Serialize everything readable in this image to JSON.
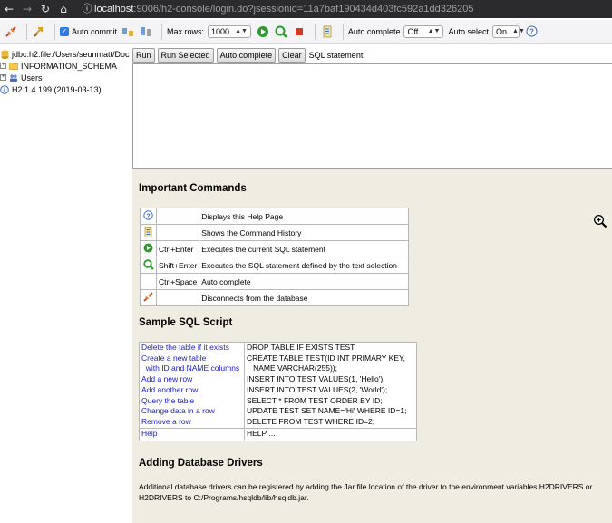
{
  "browser": {
    "back_glyph": "←",
    "forward_glyph": "→",
    "reload_glyph": "↻",
    "home_glyph": "⌂",
    "info_glyph": "ⓘ",
    "url_host": "localhost",
    "url_rest": ":9006/h2-console/login.do?jsessionid=11a7baf190434d403fc592a1dd326205"
  },
  "toolbar": {
    "auto_commit_label": "Auto commit",
    "auto_commit_checked": "✓",
    "max_rows_label": "Max rows:",
    "max_rows_value": "1000",
    "auto_complete_label": "Auto complete",
    "auto_complete_value": "Off",
    "auto_select_label": "Auto select",
    "auto_select_value": "On",
    "select_arrow": "▲▼",
    "help_glyph": "?"
  },
  "tree": {
    "connection": "jdbc:h2:file:/Users/seunmatt/Doc",
    "items": [
      {
        "label": "INFORMATION_SCHEMA"
      },
      {
        "label": "Users"
      }
    ],
    "version": "H2 1.4.199 (2019-03-13)",
    "expand_glyph": "+"
  },
  "query": {
    "run": "Run",
    "run_selected": "Run Selected",
    "auto_complete": "Auto complete",
    "clear": "Clear",
    "sql_label": "SQL statement:"
  },
  "help": {
    "important_title": "Important Commands",
    "commands": [
      {
        "icon": "help-icon",
        "key": "",
        "desc": "Displays this Help Page"
      },
      {
        "icon": "history-icon",
        "key": "",
        "desc": "Shows the Command History"
      },
      {
        "icon": "run-icon",
        "key": "Ctrl+Enter",
        "desc": "Executes the current SQL statement"
      },
      {
        "icon": "run-selected-icon",
        "key": "Shift+Enter",
        "desc": "Executes the SQL statement defined by the text selection"
      },
      {
        "icon": "",
        "key": "Ctrl+Space",
        "desc": "Auto complete"
      },
      {
        "icon": "disconnect-icon",
        "key": "",
        "desc": "Disconnects from the database"
      }
    ],
    "sample_title": "Sample SQL Script",
    "sample_rows": [
      {
        "label": "Delete the table if it exists",
        "sql": "DROP TABLE IF EXISTS TEST;"
      },
      {
        "label": "Create a new table",
        "sql": "CREATE TABLE TEST(ID INT PRIMARY KEY,"
      },
      {
        "label": "  with ID and NAME columns",
        "sql": "   NAME VARCHAR(255));"
      },
      {
        "label": "Add a new row",
        "sql": "INSERT INTO TEST VALUES(1, 'Hello');"
      },
      {
        "label": "Add another row",
        "sql": "INSERT INTO TEST VALUES(2, 'World');"
      },
      {
        "label": "Query the table",
        "sql": "SELECT * FROM TEST ORDER BY ID;"
      },
      {
        "label": "Change data in a row",
        "sql": "UPDATE TEST SET NAME='Hi' WHERE ID=1;"
      },
      {
        "label": "Remove a row",
        "sql": "DELETE FROM TEST WHERE ID=2;"
      }
    ],
    "help_row": {
      "label": "Help",
      "sql": "HELP ..."
    },
    "drivers_title": "Adding Database Drivers",
    "drivers_text_1": "Additional database drivers can be registered by adding the Jar file location of the driver to the environment variables H2DRIVERS or",
    "drivers_text_2": "H2DRIVERS to C:/Programs/hsqldb/lib/hsqldb.jar."
  },
  "colors": {
    "help_bg": "#efede2",
    "link": "#1a1ad0",
    "run_green": "#2f9a2f",
    "stop_red": "#d23a2a"
  }
}
